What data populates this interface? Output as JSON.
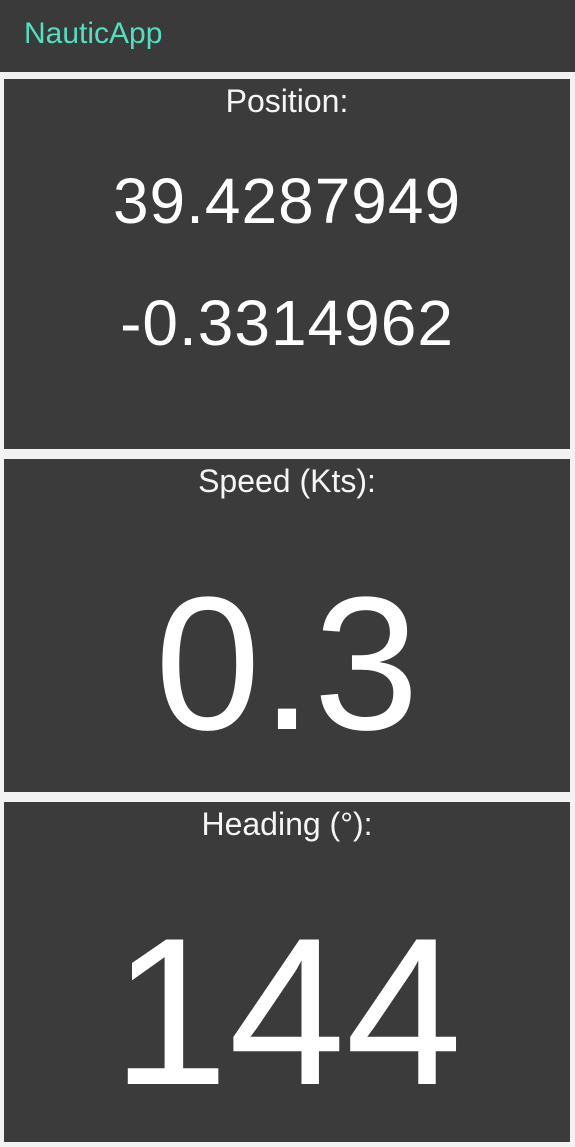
{
  "app": {
    "title": "NauticApp"
  },
  "position": {
    "label": "Position:",
    "latitude": "39.4287949",
    "longitude": "-0.3314962"
  },
  "speed": {
    "label": "Speed (Kts):",
    "value": "0.3"
  },
  "heading": {
    "label": "Heading (°):",
    "value": "144"
  },
  "colors": {
    "accent": "#4fe0c0",
    "panel_background": "#3b3b3b",
    "app_bar_background": "#3a3a3a",
    "text": "#ffffff"
  }
}
